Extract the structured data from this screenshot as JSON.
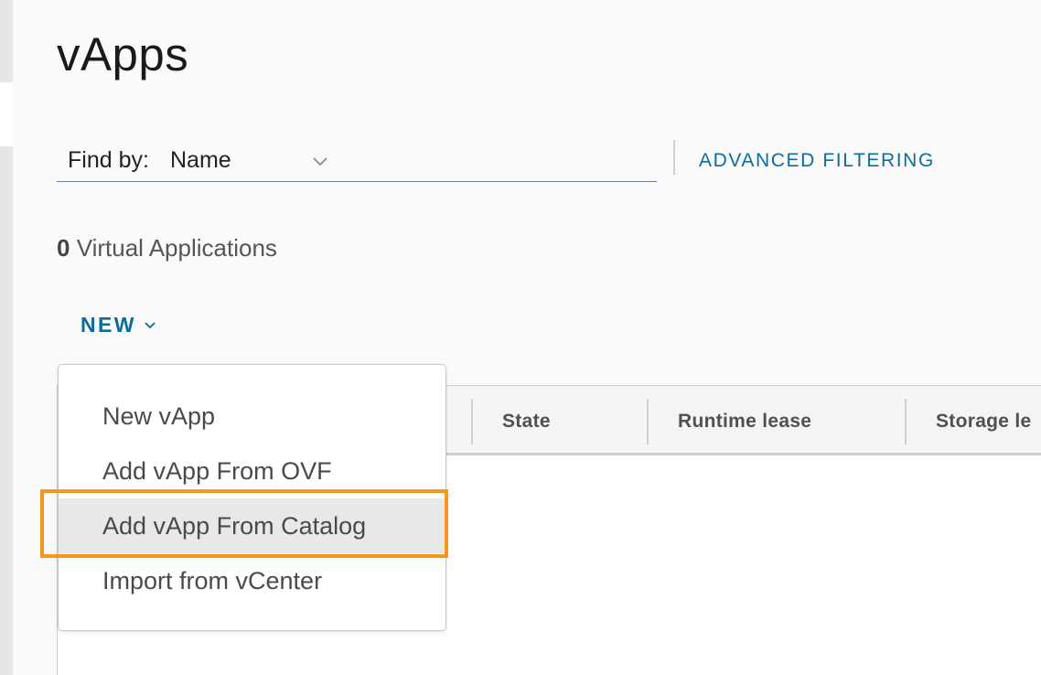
{
  "page": {
    "title": "vApps"
  },
  "filter": {
    "find_by_label": "Find by:",
    "find_by_value": "Name",
    "advanced_filtering_label": "ADVANCED FILTERING"
  },
  "summary": {
    "count": "0",
    "count_label": "Virtual Applications"
  },
  "toolbar": {
    "new_label": "NEW"
  },
  "grid": {
    "columns": [
      "State",
      "Runtime lease",
      "Storage le"
    ]
  },
  "new_menu": {
    "items": [
      {
        "label": "New vApp"
      },
      {
        "label": "Add vApp From OVF"
      },
      {
        "label": "Add vApp From Catalog"
      },
      {
        "label": "Import from vCenter"
      }
    ],
    "highlighted_index": 2
  },
  "colors": {
    "accent_link": "#0a6d9b",
    "highlight_outline": "#f7961f",
    "hover_bg": "#e8e8e8"
  },
  "icons": {
    "find_by_dropdown": "chevron-down-icon",
    "new_dropdown": "chevron-down-icon"
  }
}
